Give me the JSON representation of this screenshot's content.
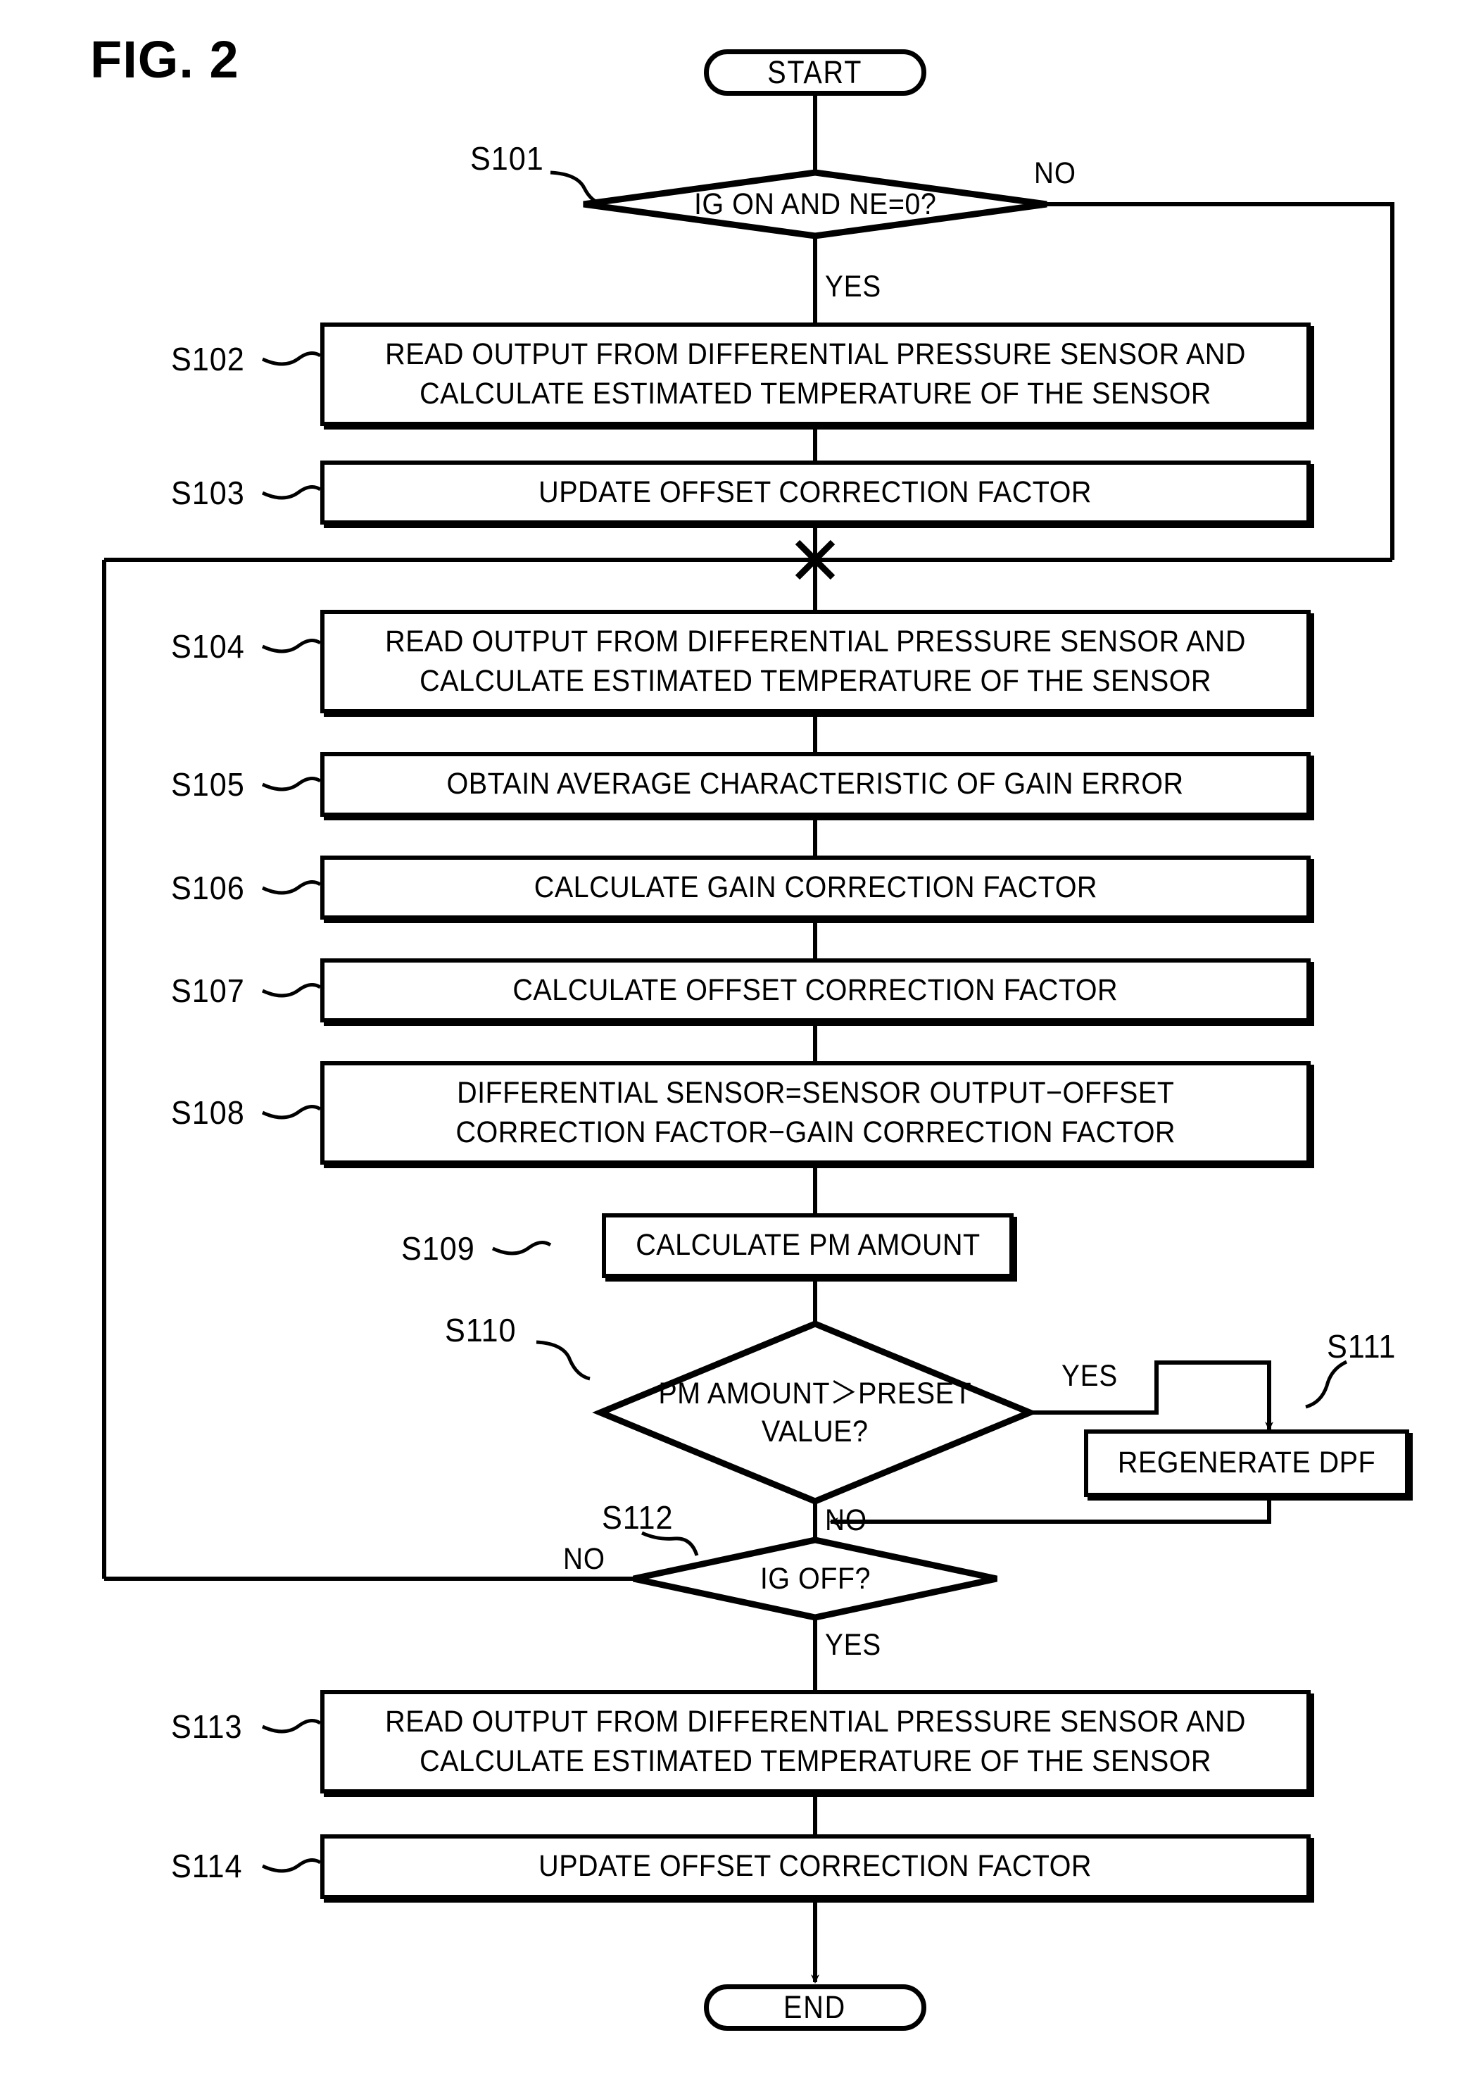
{
  "figure": {
    "title": "FIG. 2"
  },
  "nodes": {
    "start": {
      "label": "START"
    },
    "end": {
      "label": "END"
    },
    "s101": {
      "ref": "S101",
      "text": "IG ON AND NE=0?"
    },
    "s102": {
      "ref": "S102",
      "text": "READ OUTPUT FROM DIFFERENTIAL PRESSURE SENSOR AND\nCALCULATE ESTIMATED TEMPERATURE OF THE SENSOR"
    },
    "s103": {
      "ref": "S103",
      "text": "UPDATE OFFSET CORRECTION FACTOR"
    },
    "s104": {
      "ref": "S104",
      "text": "READ OUTPUT FROM DIFFERENTIAL PRESSURE SENSOR AND\nCALCULATE ESTIMATED TEMPERATURE OF THE SENSOR"
    },
    "s105": {
      "ref": "S105",
      "text": "OBTAIN AVERAGE CHARACTERISTIC OF GAIN ERROR"
    },
    "s106": {
      "ref": "S106",
      "text": "CALCULATE GAIN CORRECTION FACTOR"
    },
    "s107": {
      "ref": "S107",
      "text": "CALCULATE OFFSET CORRECTION FACTOR"
    },
    "s108": {
      "ref": "S108",
      "text": "DIFFERENTIAL SENSOR=SENSOR OUTPUT−OFFSET\nCORRECTION FACTOR−GAIN CORRECTION FACTOR"
    },
    "s109": {
      "ref": "S109",
      "text": "CALCULATE PM AMOUNT"
    },
    "s110": {
      "ref": "S110",
      "text": "PM AMOUNT＞PRESET\nVALUE?"
    },
    "s111": {
      "ref": "S111",
      "text": "REGENERATE DPF"
    },
    "s112": {
      "ref": "S112",
      "text": "IG OFF?"
    },
    "s113": {
      "ref": "S113",
      "text": "READ OUTPUT FROM DIFFERENTIAL PRESSURE SENSOR AND\nCALCULATE ESTIMATED TEMPERATURE OF THE SENSOR"
    },
    "s114": {
      "ref": "S114",
      "text": "UPDATE OFFSET CORRECTION FACTOR"
    }
  },
  "branches": {
    "s101_no": "NO",
    "s101_yes": "YES",
    "s110_yes": "YES",
    "s110_no": "NO",
    "s112_no": "NO",
    "s112_yes": "YES"
  },
  "style": {
    "line_color": "#000000",
    "background": "#ffffff"
  }
}
